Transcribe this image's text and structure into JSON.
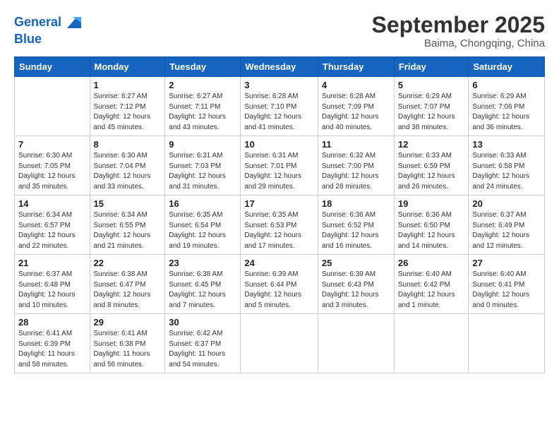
{
  "header": {
    "logo_line1": "General",
    "logo_line2": "Blue",
    "month": "September 2025",
    "location": "Baima, Chongqing, China"
  },
  "weekdays": [
    "Sunday",
    "Monday",
    "Tuesday",
    "Wednesday",
    "Thursday",
    "Friday",
    "Saturday"
  ],
  "weeks": [
    [
      {
        "day": "",
        "info": ""
      },
      {
        "day": "1",
        "info": "Sunrise: 6:27 AM\nSunset: 7:12 PM\nDaylight: 12 hours\nand 45 minutes."
      },
      {
        "day": "2",
        "info": "Sunrise: 6:27 AM\nSunset: 7:11 PM\nDaylight: 12 hours\nand 43 minutes."
      },
      {
        "day": "3",
        "info": "Sunrise: 6:28 AM\nSunset: 7:10 PM\nDaylight: 12 hours\nand 41 minutes."
      },
      {
        "day": "4",
        "info": "Sunrise: 6:28 AM\nSunset: 7:09 PM\nDaylight: 12 hours\nand 40 minutes."
      },
      {
        "day": "5",
        "info": "Sunrise: 6:29 AM\nSunset: 7:07 PM\nDaylight: 12 hours\nand 38 minutes."
      },
      {
        "day": "6",
        "info": "Sunrise: 6:29 AM\nSunset: 7:06 PM\nDaylight: 12 hours\nand 36 minutes."
      }
    ],
    [
      {
        "day": "7",
        "info": "Sunrise: 6:30 AM\nSunset: 7:05 PM\nDaylight: 12 hours\nand 35 minutes."
      },
      {
        "day": "8",
        "info": "Sunrise: 6:30 AM\nSunset: 7:04 PM\nDaylight: 12 hours\nand 33 minutes."
      },
      {
        "day": "9",
        "info": "Sunrise: 6:31 AM\nSunset: 7:03 PM\nDaylight: 12 hours\nand 31 minutes."
      },
      {
        "day": "10",
        "info": "Sunrise: 6:31 AM\nSunset: 7:01 PM\nDaylight: 12 hours\nand 29 minutes."
      },
      {
        "day": "11",
        "info": "Sunrise: 6:32 AM\nSunset: 7:00 PM\nDaylight: 12 hours\nand 28 minutes."
      },
      {
        "day": "12",
        "info": "Sunrise: 6:33 AM\nSunset: 6:59 PM\nDaylight: 12 hours\nand 26 minutes."
      },
      {
        "day": "13",
        "info": "Sunrise: 6:33 AM\nSunset: 6:58 PM\nDaylight: 12 hours\nand 24 minutes."
      }
    ],
    [
      {
        "day": "14",
        "info": "Sunrise: 6:34 AM\nSunset: 6:57 PM\nDaylight: 12 hours\nand 22 minutes."
      },
      {
        "day": "15",
        "info": "Sunrise: 6:34 AM\nSunset: 6:55 PM\nDaylight: 12 hours\nand 21 minutes."
      },
      {
        "day": "16",
        "info": "Sunrise: 6:35 AM\nSunset: 6:54 PM\nDaylight: 12 hours\nand 19 minutes."
      },
      {
        "day": "17",
        "info": "Sunrise: 6:35 AM\nSunset: 6:53 PM\nDaylight: 12 hours\nand 17 minutes."
      },
      {
        "day": "18",
        "info": "Sunrise: 6:36 AM\nSunset: 6:52 PM\nDaylight: 12 hours\nand 16 minutes."
      },
      {
        "day": "19",
        "info": "Sunrise: 6:36 AM\nSunset: 6:50 PM\nDaylight: 12 hours\nand 14 minutes."
      },
      {
        "day": "20",
        "info": "Sunrise: 6:37 AM\nSunset: 6:49 PM\nDaylight: 12 hours\nand 12 minutes."
      }
    ],
    [
      {
        "day": "21",
        "info": "Sunrise: 6:37 AM\nSunset: 6:48 PM\nDaylight: 12 hours\nand 10 minutes."
      },
      {
        "day": "22",
        "info": "Sunrise: 6:38 AM\nSunset: 6:47 PM\nDaylight: 12 hours\nand 8 minutes."
      },
      {
        "day": "23",
        "info": "Sunrise: 6:38 AM\nSunset: 6:45 PM\nDaylight: 12 hours\nand 7 minutes."
      },
      {
        "day": "24",
        "info": "Sunrise: 6:39 AM\nSunset: 6:44 PM\nDaylight: 12 hours\nand 5 minutes."
      },
      {
        "day": "25",
        "info": "Sunrise: 6:39 AM\nSunset: 6:43 PM\nDaylight: 12 hours\nand 3 minutes."
      },
      {
        "day": "26",
        "info": "Sunrise: 6:40 AM\nSunset: 6:42 PM\nDaylight: 12 hours\nand 1 minute."
      },
      {
        "day": "27",
        "info": "Sunrise: 6:40 AM\nSunset: 6:41 PM\nDaylight: 12 hours\nand 0 minutes."
      }
    ],
    [
      {
        "day": "28",
        "info": "Sunrise: 6:41 AM\nSunset: 6:39 PM\nDaylight: 11 hours\nand 58 minutes."
      },
      {
        "day": "29",
        "info": "Sunrise: 6:41 AM\nSunset: 6:38 PM\nDaylight: 11 hours\nand 56 minutes."
      },
      {
        "day": "30",
        "info": "Sunrise: 6:42 AM\nSunset: 6:37 PM\nDaylight: 11 hours\nand 54 minutes."
      },
      {
        "day": "",
        "info": ""
      },
      {
        "day": "",
        "info": ""
      },
      {
        "day": "",
        "info": ""
      },
      {
        "day": "",
        "info": ""
      }
    ]
  ]
}
